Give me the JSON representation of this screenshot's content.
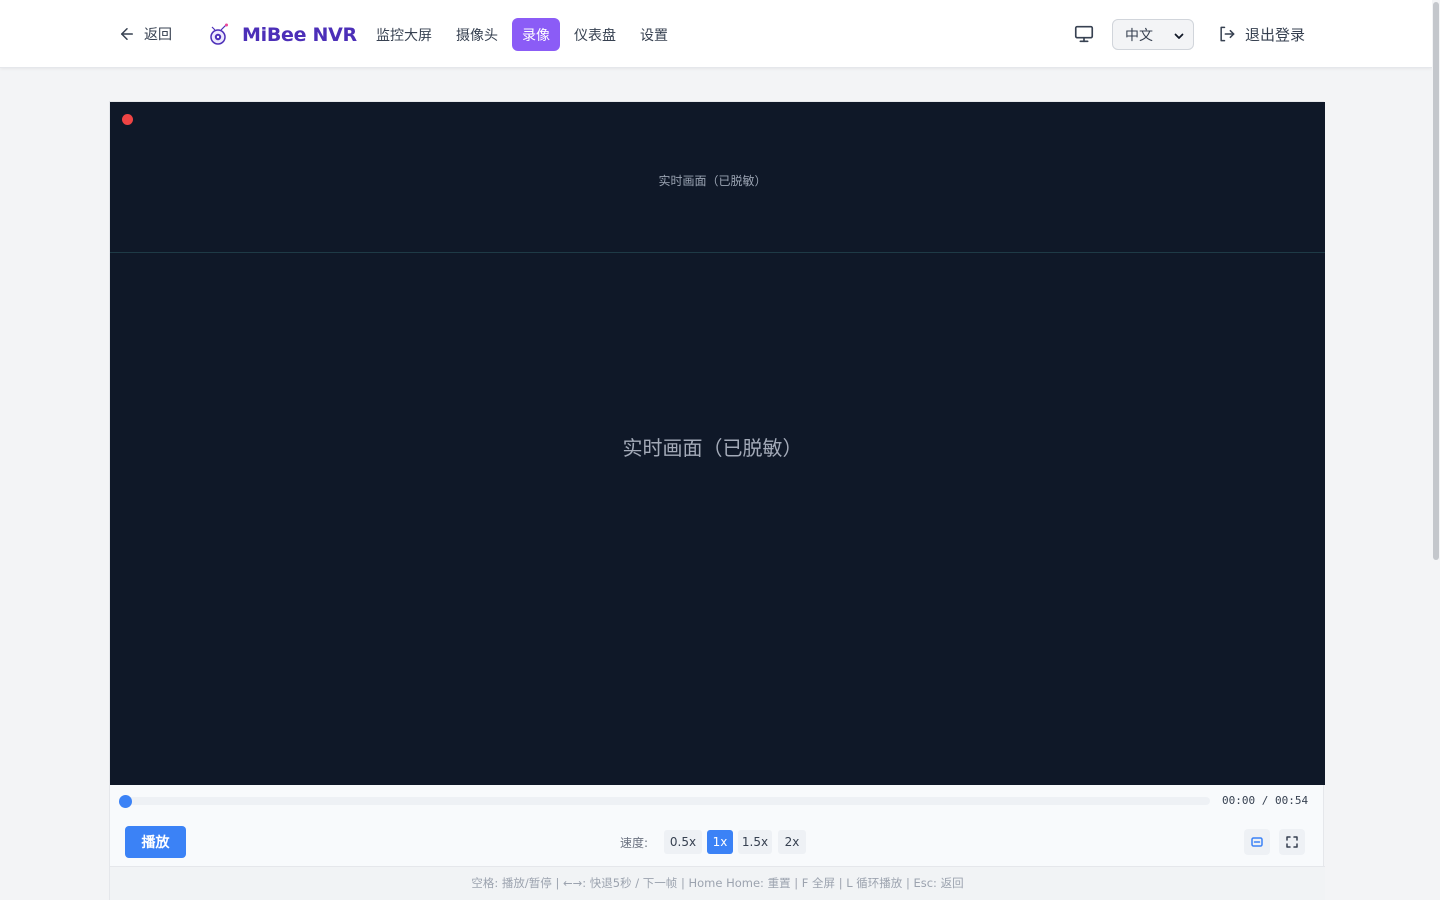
{
  "header": {
    "back_label": "返回",
    "app_name": "MiBee NVR",
    "nav": [
      {
        "label": "监控大屏"
      },
      {
        "label": "摄像头"
      },
      {
        "label": "录像",
        "active": true
      },
      {
        "label": "仪表盘"
      },
      {
        "label": "设置"
      }
    ],
    "language": "中文",
    "logout_label": "退出登录"
  },
  "player": {
    "small_label": "实时画面（已脱敏）",
    "center_label": "实时画面（已脱敏）",
    "current_time": "00:00",
    "total_time": "00:54",
    "time_display": "00:00 / 00:54",
    "progress": 0,
    "play_label": "播放",
    "speed_label": "速度:",
    "speeds": [
      "0.5x",
      "1x",
      "1.5x",
      "2x"
    ],
    "active_speed": "1x",
    "shortcuts": "空格: 播放/暂停 | ←→: 快退5秒 / 下一帧 | Home Home: 重置 | F 全屏 | L 循环播放 | Esc: 返回"
  },
  "colors": {
    "accent": "#8b5cf6",
    "primary": "#3b82f6",
    "brand": "#4c2fb8",
    "video_bg": "#0f1828",
    "rec": "#ef4444"
  },
  "icons": [
    "arrow-left-icon",
    "bee-logo-icon",
    "monitor-icon",
    "chevron-down-icon",
    "logout-icon",
    "loop-icon",
    "fullscreen-icon"
  ]
}
